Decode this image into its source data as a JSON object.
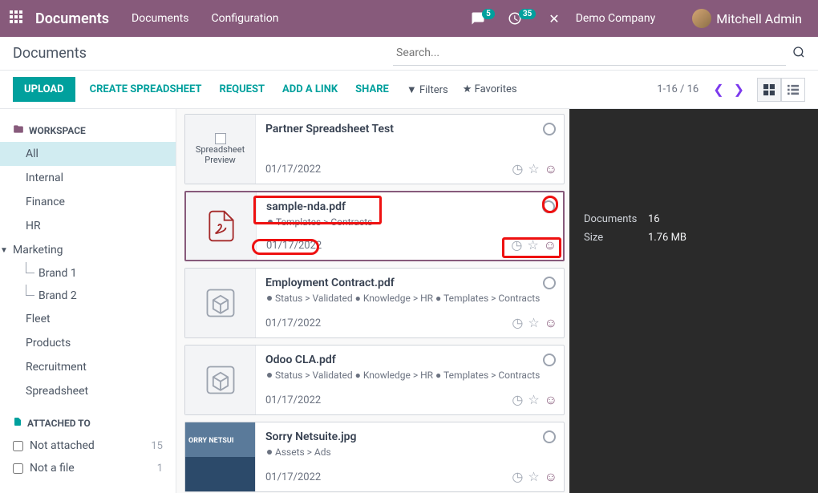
{
  "topbar": {
    "brand": "Documents",
    "nav": [
      "Documents",
      "Configuration"
    ],
    "msg_badge": "5",
    "clock_badge": "35",
    "company": "Demo Company",
    "user": "Mitchell Admin"
  },
  "header": {
    "title": "Documents",
    "search_placeholder": "Search..."
  },
  "toolbar": {
    "upload": "UPLOAD",
    "create_spreadsheet": "CREATE SPREADSHEET",
    "request": "REQUEST",
    "add_link": "ADD A LINK",
    "share": "SHARE",
    "filters": "Filters",
    "favorites": "Favorites",
    "pager": "1-16 / 16"
  },
  "sidebar": {
    "workspace_label": "WORKSPACE",
    "attached_label": "ATTACHED TO",
    "items": [
      "All",
      "Internal",
      "Finance",
      "HR",
      "Marketing",
      "Fleet",
      "Products",
      "Recruitment",
      "Spreadsheet"
    ],
    "marketing_children": [
      "Brand 1",
      "Brand 2"
    ],
    "not_attached": "Not attached",
    "not_attached_count": "15",
    "not_a_file": "Not a file",
    "not_a_file_count": "1"
  },
  "docs": [
    {
      "title": "Partner Spreadsheet Test",
      "tags": "",
      "date": "01/17/2022",
      "thumb": "spreadsheet"
    },
    {
      "title": "sample-nda.pdf",
      "tags": "Templates > Contracts",
      "date": "01/17/2022",
      "thumb": "pdf"
    },
    {
      "title": "Employment Contract.pdf",
      "tags": "Status > Validated ● Knowledge > HR ● Templates > Contracts",
      "date": "01/17/2022",
      "thumb": "box"
    },
    {
      "title": "Odoo CLA.pdf",
      "tags": "Status > Validated ● Knowledge > HR ● Templates > Contracts",
      "date": "01/17/2022",
      "thumb": "box"
    },
    {
      "title": "Sorry Netsuite.jpg",
      "tags": "Assets > Ads",
      "date": "01/17/2022",
      "thumb": "img"
    }
  ],
  "info": {
    "docs_label": "Documents",
    "docs_val": "16",
    "size_label": "Size",
    "size_val": "1.76 MB"
  },
  "thumb_text": {
    "spreadsheet_l1": "Spreadsheet",
    "spreadsheet_l2": "Preview",
    "netsuite": "ORRY NETSUI"
  }
}
